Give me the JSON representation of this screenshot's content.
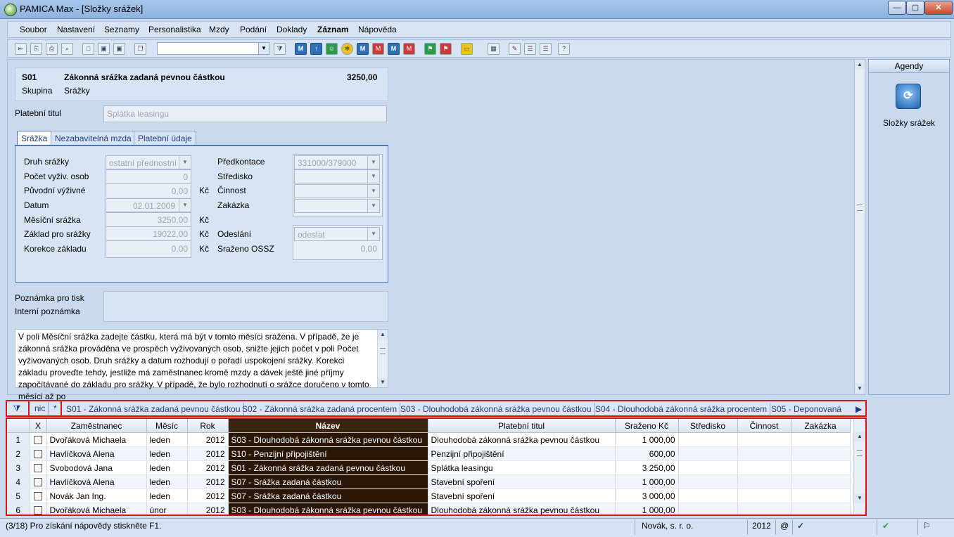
{
  "window": {
    "title": "PAMICA Max - [Složky srážek]",
    "minimize": "—",
    "maximize": "▢",
    "close": "✕"
  },
  "menu": [
    "Soubor",
    "Nastavení",
    "Seznamy",
    "Personalistika",
    "Mzdy",
    "Podání",
    "Doklady",
    "Záznam",
    "Nápověda"
  ],
  "header": {
    "code": "S01",
    "name": "Zákonná srážka zadaná pevnou částkou",
    "amount": "3250,00",
    "group_label": "Skupina",
    "group_value": "Srážky"
  },
  "payment_title": {
    "label": "Platební titul",
    "value": "Splátka leasingu"
  },
  "tabs": [
    "Srážka",
    "Nezabavitelná mzda",
    "Platební údaje"
  ],
  "form": {
    "type_label": "Druh srážky",
    "type_value": "ostatní přednostní",
    "dependents_label": "Počet vyživ. osob",
    "dependents_value": "0",
    "original_label": "Původní výživné",
    "original_value": "0,00",
    "date_label": "Datum",
    "date_value": "02.01.2009",
    "monthly_label": "Měsíční srážka",
    "monthly_value": "3250,00",
    "base_label": "Základ pro srážky",
    "base_value": "19022,00",
    "correction_label": "Korekce základu",
    "correction_value": "0,00",
    "currency": "Kč",
    "precontract_label": "Předkontace",
    "precontract_value": "331000/379000",
    "center_label": "Středisko",
    "activity_label": "Činnost",
    "order_label": "Zakázka",
    "sending_label": "Odeslání",
    "sending_value": "odeslat",
    "ossz_label": "Sraženo OSSZ",
    "ossz_value": "0,00"
  },
  "notes": {
    "print_label": "Poznámka pro tisk",
    "internal_label": "Interní poznámka"
  },
  "info_text": "V poli Měsíční srážka zadejte částku, která má být v tomto měsíci sražena. V případě, že je zákonná srážka prováděna ve prospěch vyživovaných osob, snižte jejich počet v poli Počet vyživovaných osob. Druh srážky a datum rozhodují o pořadí uspokojení srážky. Korekci základu proveďte tehdy, jestliže má zaměstnanec kromě mzdy a dávek ještě jiné příjmy započítávané do základu pro srážky. V případě, že bylo rozhodnutí o srážce doručeno v tomto měsíci až po",
  "agenda": {
    "header": "Agendy",
    "item_label": "Složky srážek"
  },
  "filter_tabs": [
    "nic",
    "*",
    "S01 - Zákonná srážka zadaná pevnou částkou",
    "S02 - Zákonná srážka zadaná procentem",
    "S03 - Dlouhodobá zákonná srážka pevnou částkou",
    "S04 - Dlouhodobá zákonná srážka procentem",
    "S05 - Deponovaná"
  ],
  "grid": {
    "columns": [
      "X",
      "Zaměstnanec",
      "Měsíc",
      "Rok",
      "Název",
      "Platební titul",
      "Sraženo Kč",
      "Středisko",
      "Činnost",
      "Zakázka"
    ],
    "rows": [
      {
        "n": "1",
        "employee": "Dvořáková Michaela",
        "month": "leden",
        "year": "2012",
        "name": "S03 - Dlouhodobá zákonná srážka pevnou částkou",
        "title": "Dlouhodobá zákonná srážka pevnou částkou",
        "amount": "1 000,00"
      },
      {
        "n": "2",
        "employee": "Havlíčková Alena",
        "month": "leden",
        "year": "2012",
        "name": "S10 - Penzijní připojištění",
        "title": "Penzijní připojištění",
        "amount": "600,00"
      },
      {
        "n": "3",
        "employee": "Svobodová Jana",
        "month": "leden",
        "year": "2012",
        "name": "S01 - Zákonná srážka zadaná pevnou částkou",
        "title": "Splátka leasingu",
        "amount": "3 250,00"
      },
      {
        "n": "4",
        "employee": "Havlíčková Alena",
        "month": "leden",
        "year": "2012",
        "name": "S07 - Srážka zadaná částkou",
        "title": "Stavební spoření",
        "amount": "1 000,00"
      },
      {
        "n": "5",
        "employee": "Novák Jan Ing.",
        "month": "leden",
        "year": "2012",
        "name": "S07 - Srážka zadaná částkou",
        "title": "Stavební spoření",
        "amount": "3 000,00"
      },
      {
        "n": "6",
        "employee": "Dvořáková Michaela",
        "month": "únor",
        "year": "2012",
        "name": "S03 - Dlouhodobá zákonná srážka pevnou částkou",
        "title": "Dlouhodobá zákonná srážka pevnou částkou",
        "amount": "1 000,00"
      }
    ]
  },
  "status": {
    "record": "(3/18) Pro získání nápovědy stiskněte F1.",
    "company": "Novák, s. r. o.",
    "year": "2012",
    "at": "@"
  }
}
